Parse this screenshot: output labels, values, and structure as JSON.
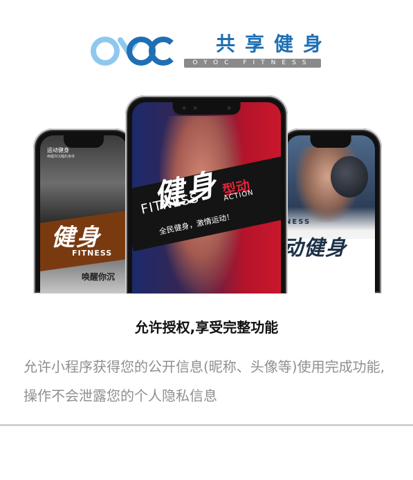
{
  "brand": {
    "name_cn": "共享健身",
    "name_en": "OYOC FITNESS",
    "logo_mark_icon": "oyoc-rings-logo-icon",
    "colors": {
      "blue": "#1e6fb3",
      "light_blue": "#8ec8ee",
      "gray": "#8a8a8a"
    }
  },
  "screens": {
    "left": {
      "tag": "运动健身",
      "tag_sub": "唤醒你沉睡的身体",
      "big": "健身",
      "fitness": "FITNESS",
      "slogan": "唤醒你沉"
    },
    "center": {
      "big": "健身",
      "action_cn": "型动",
      "fitness": "FITNESS",
      "action": "ACTION",
      "slogan": "全民健身，激情运动！"
    },
    "right": {
      "fitness": "NESS",
      "big": "动健身"
    }
  },
  "dialog": {
    "title": "允许授权,享受完整功能",
    "description": "允许小程序获得您的公开信息(昵称、头像等)使用完成功能,操作不会泄露您的个人隐私信息"
  }
}
